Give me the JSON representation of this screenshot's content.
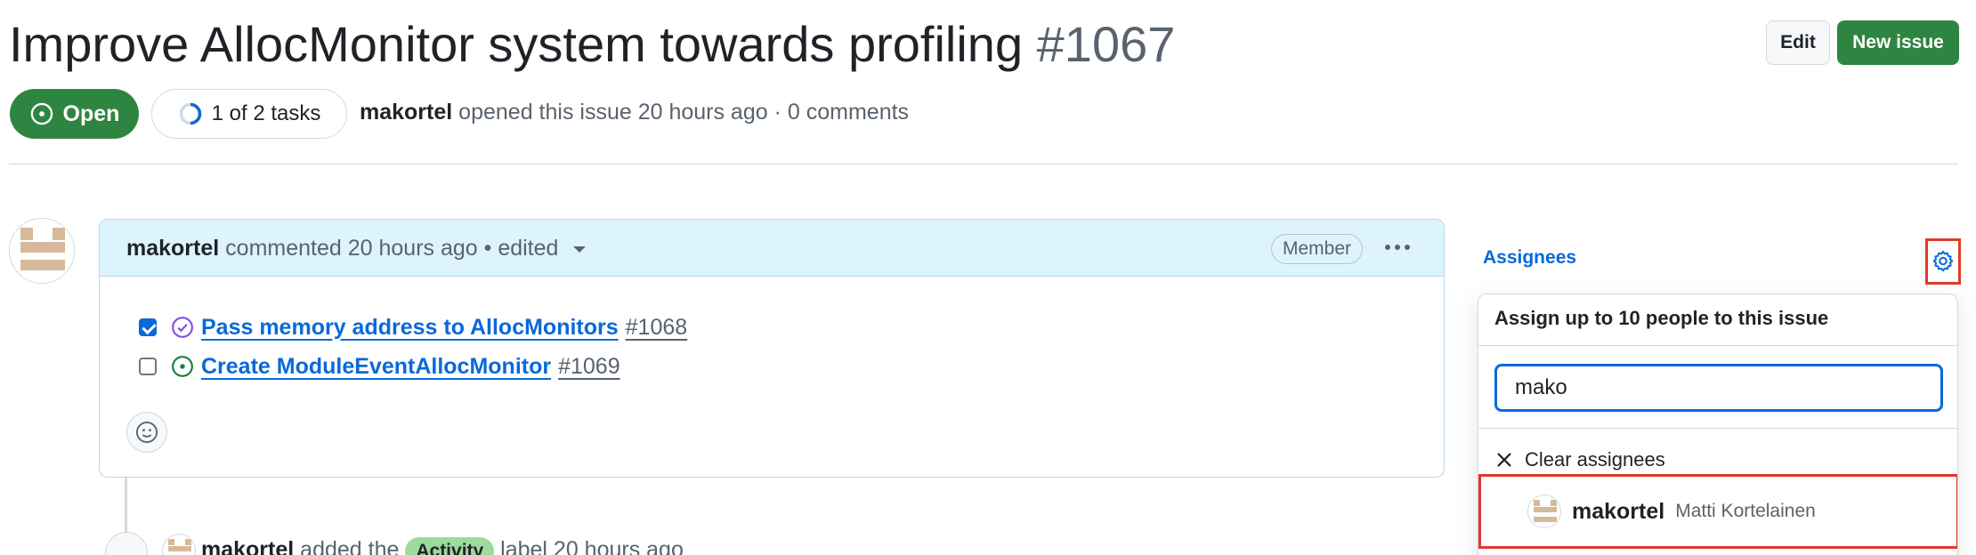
{
  "issue": {
    "title": "Improve AllocMonitor system towards profiling",
    "number": "#1067",
    "state": "Open",
    "tasks_progress": "1 of 2 tasks",
    "author": "makortel",
    "opened_text": "opened this issue 20 hours ago",
    "comments_text": "· 0 comments"
  },
  "header_actions": {
    "edit_label": "Edit",
    "new_issue_label": "New issue"
  },
  "comment": {
    "author": "makortel",
    "meta": "commented 20 hours ago • edited",
    "badge": "Member",
    "tasks": [
      {
        "checked": true,
        "title": "Pass memory address to AllocMonitors",
        "ref": "#1068",
        "status": "closed"
      },
      {
        "checked": false,
        "title": "Create ModuleEventAllocMonitor",
        "ref": "#1069",
        "status": "open"
      }
    ]
  },
  "timeline": {
    "actor": "makortel",
    "action": "added the",
    "label": "Activity",
    "suffix": "label 20 hours ago"
  },
  "sidebar": {
    "assignees_title": "Assignees",
    "popover": {
      "title": "Assign up to 10 people to this issue",
      "search_value": "mako",
      "clear_label": "Clear assignees",
      "results": [
        {
          "login": "makortel",
          "name": "Matti Kortelainen"
        }
      ]
    }
  },
  "colors": {
    "open_green": "#2e8541",
    "link_blue": "#0969da",
    "highlight_red": "#e03a2b",
    "label_activity": "#9ed99e"
  }
}
